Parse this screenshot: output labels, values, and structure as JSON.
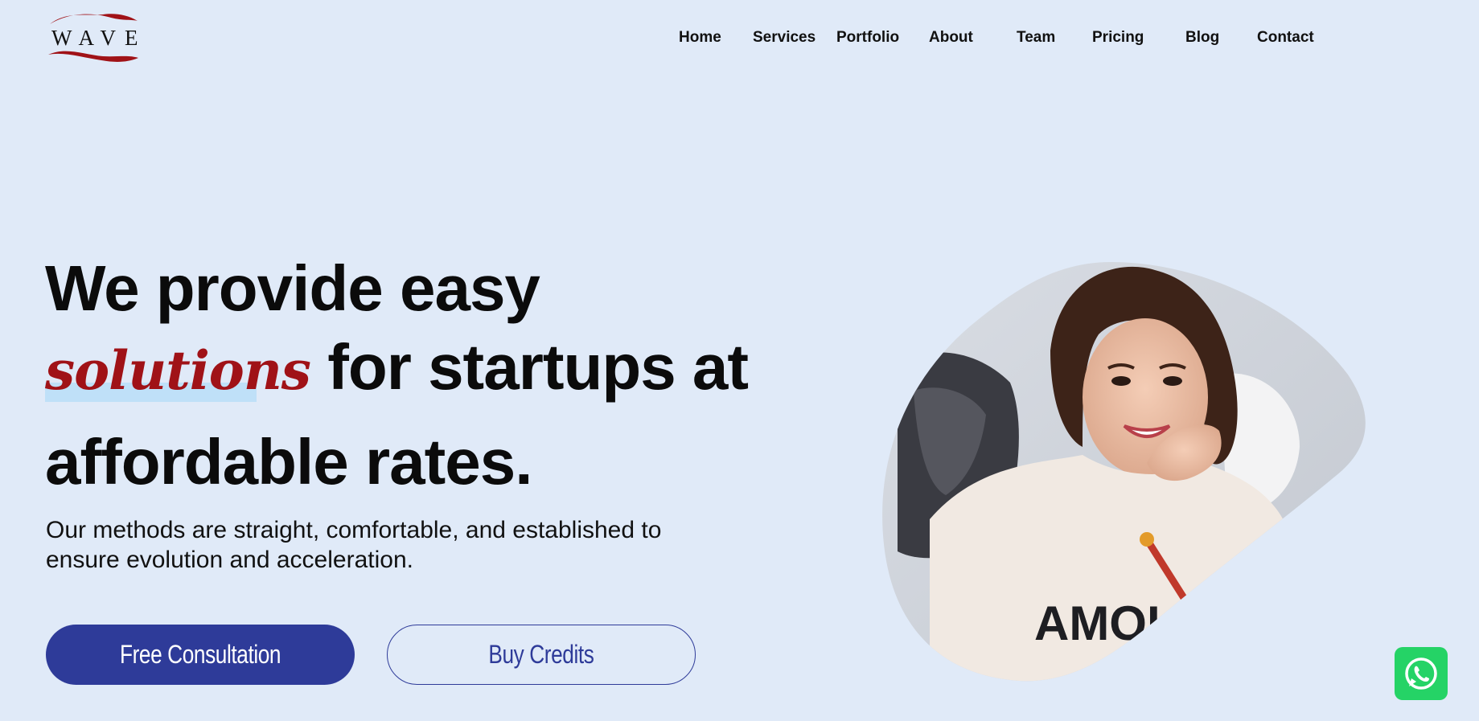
{
  "logo": {
    "text": "WAVE",
    "color": "#a01217"
  },
  "nav": {
    "items": [
      {
        "label": "Home"
      },
      {
        "label": "Services"
      },
      {
        "label": "Portfolio"
      },
      {
        "label": "About"
      },
      {
        "label": "Team"
      },
      {
        "label": "Pricing"
      },
      {
        "label": "Blog"
      },
      {
        "label": "Contact"
      }
    ]
  },
  "hero": {
    "line1": "We provide easy",
    "highlight": "solutions",
    "line2_rest": " for startups at",
    "line3": "affordable rates.",
    "subtitle": "Our methods are straight, comfortable, and established to ensure evolution and acceleration.",
    "primary_button": "Free Consultation",
    "secondary_button": "Buy Credits",
    "image_icon": "smiling-woman-photo"
  },
  "whatsapp": {
    "icon": "whatsapp-icon",
    "color": "#25d366"
  },
  "colors": {
    "background": "#e0eaf8",
    "accent": "#2e3b99",
    "brand_red": "#a01217"
  }
}
